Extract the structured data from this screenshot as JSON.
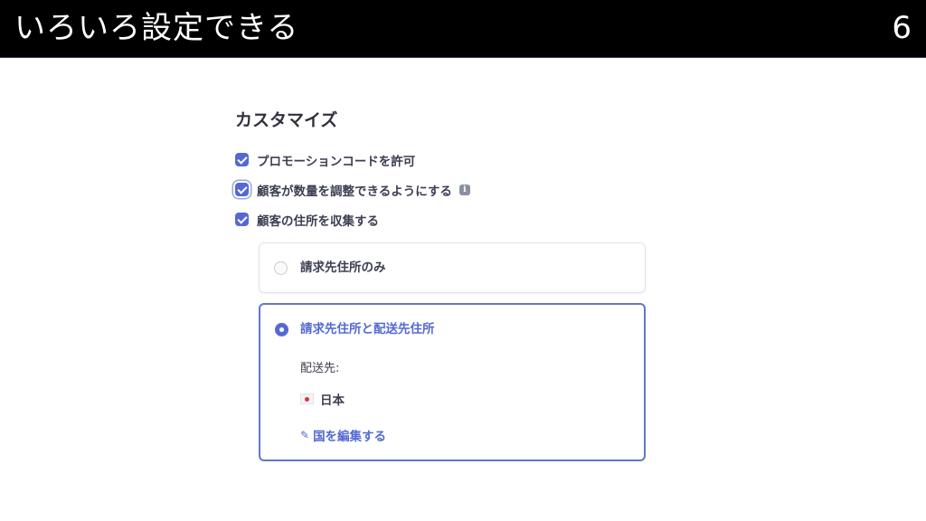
{
  "header": {
    "title": "いろいろ設定できる",
    "page_number": "6"
  },
  "customize": {
    "title": "カスタマイズ",
    "options": [
      {
        "label": "プロモーションコードを許可",
        "checked": true
      },
      {
        "label": "顧客が数量を調整できるようにする",
        "checked": true,
        "info_icon": "info-icon"
      },
      {
        "label": "顧客の住所を収集する",
        "checked": true
      }
    ],
    "address_choices": [
      {
        "label": "請求先住所のみ",
        "selected": false
      },
      {
        "label": "請求先住所と配送先住所",
        "selected": true
      }
    ],
    "shipping_label": "配送先:",
    "country": {
      "name": "日本",
      "flag_icon": "japan-flag-icon"
    },
    "edit_link": "国を編集する",
    "edit_icon": "pencil-icon"
  },
  "colors": {
    "accent": "#5469d4",
    "header_bg": "#000000",
    "text": "#30313d"
  }
}
